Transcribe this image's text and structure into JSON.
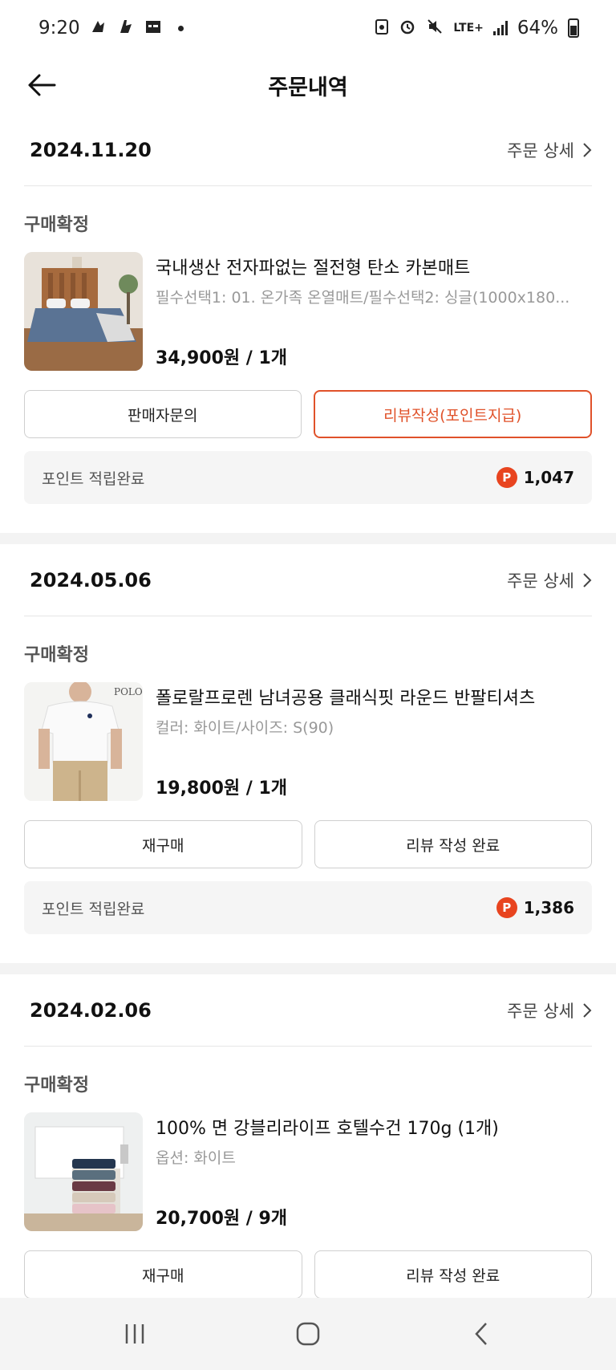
{
  "status_bar": {
    "time": "9:20",
    "lte": "LTE+",
    "battery": "64%"
  },
  "header": {
    "title": "주문내역"
  },
  "detail_label": "주문 상세",
  "orders": [
    {
      "date": "2024.11.20",
      "status": "구매확정",
      "product_name": "국내생산 전자파없는 절전형 탄소 카본매트",
      "product_option": "필수선택1: 01. 온가족 온열매트/필수선택2: 싱글(1000x180...",
      "price_qty": "34,900원 / 1개",
      "btn_left": "판매자문의",
      "btn_right": "리뷰작성(포인트지급)",
      "point_label": "포인트 적립완료",
      "point_value": "1,047"
    },
    {
      "date": "2024.05.06",
      "status": "구매확정",
      "product_name": "폴로랄프로렌 남녀공용 클래식핏 라운드 반팔티셔츠",
      "product_option": "컬러: 화이트/사이즈: S(90)",
      "price_qty": "19,800원 / 1개",
      "btn_left": "재구매",
      "btn_right": "리뷰 작성 완료",
      "point_label": "포인트 적립완료",
      "point_value": "1,386",
      "thumb_text": "POLO"
    },
    {
      "date": "2024.02.06",
      "status": "구매확정",
      "product_name": "100% 면 강블리라이프 호텔수건 170g (1개)",
      "product_option": "옵션: 화이트",
      "price_qty": "20,700원 / 9개",
      "btn_left": "재구매",
      "btn_right": "리뷰 작성 완료"
    }
  ],
  "point_badge": "P",
  "colors": {
    "accent": "#e0522a",
    "point_badge": "#e8441f"
  }
}
